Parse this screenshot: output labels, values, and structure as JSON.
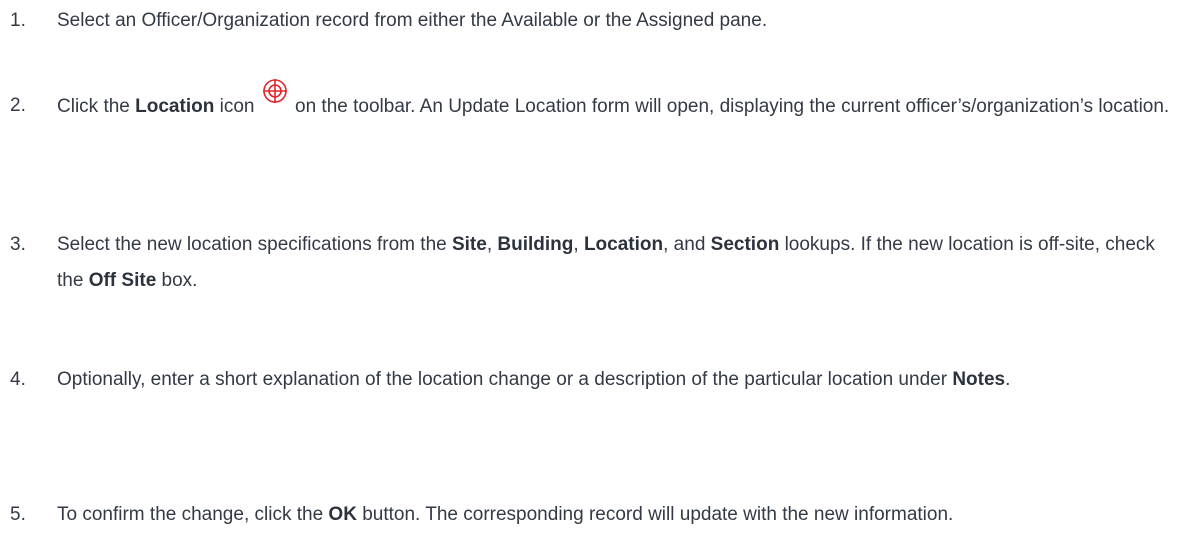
{
  "steps": [
    {
      "num": "1.",
      "parts": [
        {
          "t": "Select an Officer/Organization record from either the Available or the Assigned pane."
        }
      ]
    },
    {
      "num": "2.",
      "parts": [
        {
          "t": "Click the "
        },
        {
          "b": "Location"
        },
        {
          "t": " icon "
        },
        {
          "icon": "location-target-icon"
        },
        {
          "t": " on the toolbar. An Update Location form will open, displaying the current officer’s/organization’s location."
        }
      ]
    },
    {
      "num": "3.",
      "parts": [
        {
          "t": "Select the new location specifications from the "
        },
        {
          "b": "Site"
        },
        {
          "t": ", "
        },
        {
          "b": "Building"
        },
        {
          "t": ", "
        },
        {
          "b": "Location"
        },
        {
          "t": ", and "
        },
        {
          "b": "Section"
        },
        {
          "t": " lookups. If the new location is off-site, check the "
        },
        {
          "b": "Off Site"
        },
        {
          "t": " box."
        }
      ]
    },
    {
      "num": "4.",
      "parts": [
        {
          "t": "Optionally, enter a short explanation of the location change or a description of the particular location under "
        },
        {
          "b": "Notes"
        },
        {
          "t": "."
        }
      ]
    },
    {
      "num": "5.",
      "parts": [
        {
          "t": "To confirm the change, click the "
        },
        {
          "b": "OK"
        },
        {
          "t": " button. The corresponding record will update with the new information."
        }
      ]
    }
  ],
  "colors": {
    "text": "#333a45",
    "icon_accent": "#e0262b"
  }
}
